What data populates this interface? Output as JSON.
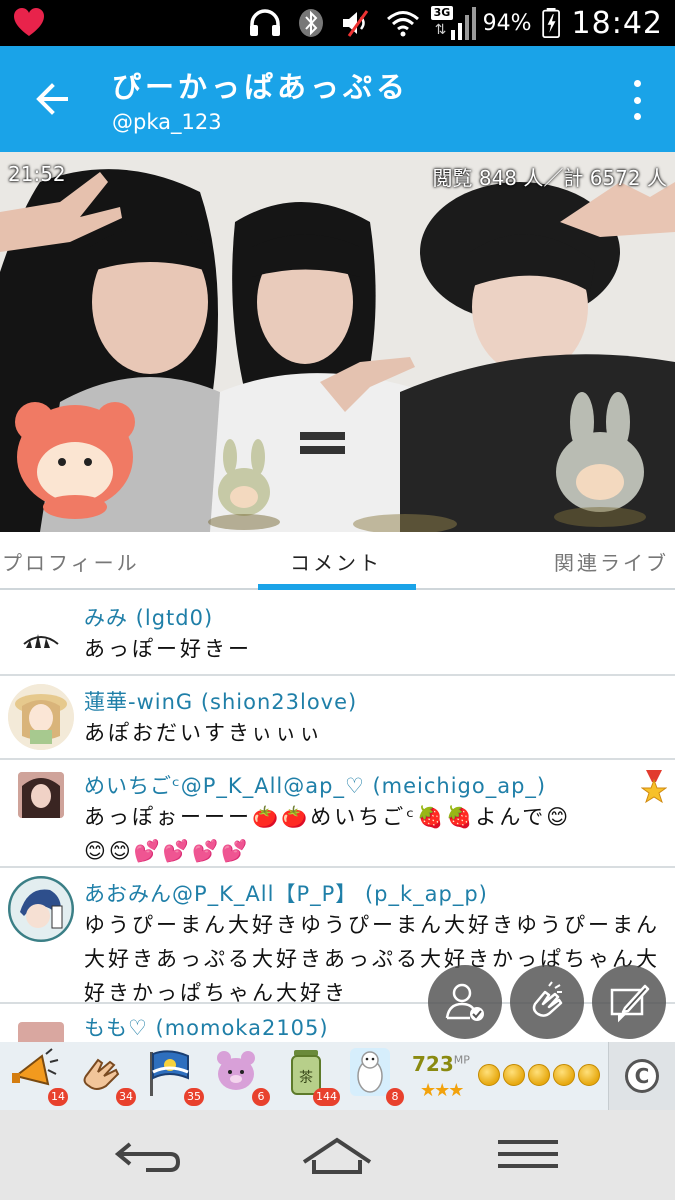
{
  "status_bar": {
    "battery_percent": "94%",
    "time": "18:42",
    "network_type": "3G",
    "icons": [
      "heart-icon",
      "headphones-icon",
      "bluetooth-icon",
      "mute-icon",
      "wifi-icon",
      "signal-icon",
      "battery-icon"
    ]
  },
  "header": {
    "title": "ぴーかっぱあっぷる",
    "handle": "@pka_123",
    "bg_color": "#1aa3e8"
  },
  "video": {
    "elapsed_time": "21:52",
    "viewers_text": "閲覧 848 人／計 6572 人"
  },
  "tabs": [
    {
      "label": "プロフィール",
      "active": false
    },
    {
      "label": "コメント",
      "active": true
    },
    {
      "label": "関連ライブ",
      "active": false
    }
  ],
  "comments": [
    {
      "name": "みみ (lgtd0)",
      "text": "あっぽー好きー"
    },
    {
      "name": "蓮華-winG (shion23love)",
      "text": "あぽおだいすきぃぃぃ"
    },
    {
      "name": "めいちごᶜ@P_K_All@ap_♡ (meichigo_ap_)",
      "text": "あっぽぉーーー🍅🍅めいちごᶜ🍓🍓よんで😊😊😊💕💕💕💕"
    },
    {
      "name": "あおみん@P_K_All【P_P】 (p_k_ap_p)",
      "text": "ゆうぴーまん大好きゆうぴーまん大好きゆうぴーまん大好きあっぷる大好きあっぷる大好きかっぱちゃん大好きかっぱちゃん大好き"
    },
    {
      "name": "もも♡ (momoka2105)",
      "text": ""
    }
  ],
  "gifts": [
    {
      "icon": "megaphone-icon",
      "count": "14"
    },
    {
      "icon": "clap-icon",
      "count": "34"
    },
    {
      "icon": "flag-icon",
      "count": "35"
    },
    {
      "icon": "bear-icon",
      "count": "6"
    },
    {
      "icon": "tea-icon",
      "count": "144"
    },
    {
      "icon": "polar-bear-icon",
      "count": "8"
    }
  ],
  "mp": {
    "value": "723",
    "unit": "MP",
    "stars": "★★★"
  },
  "coin_count": 5,
  "c_button_label": "C",
  "nav": [
    "back-icon",
    "home-icon",
    "menu-icon"
  ]
}
